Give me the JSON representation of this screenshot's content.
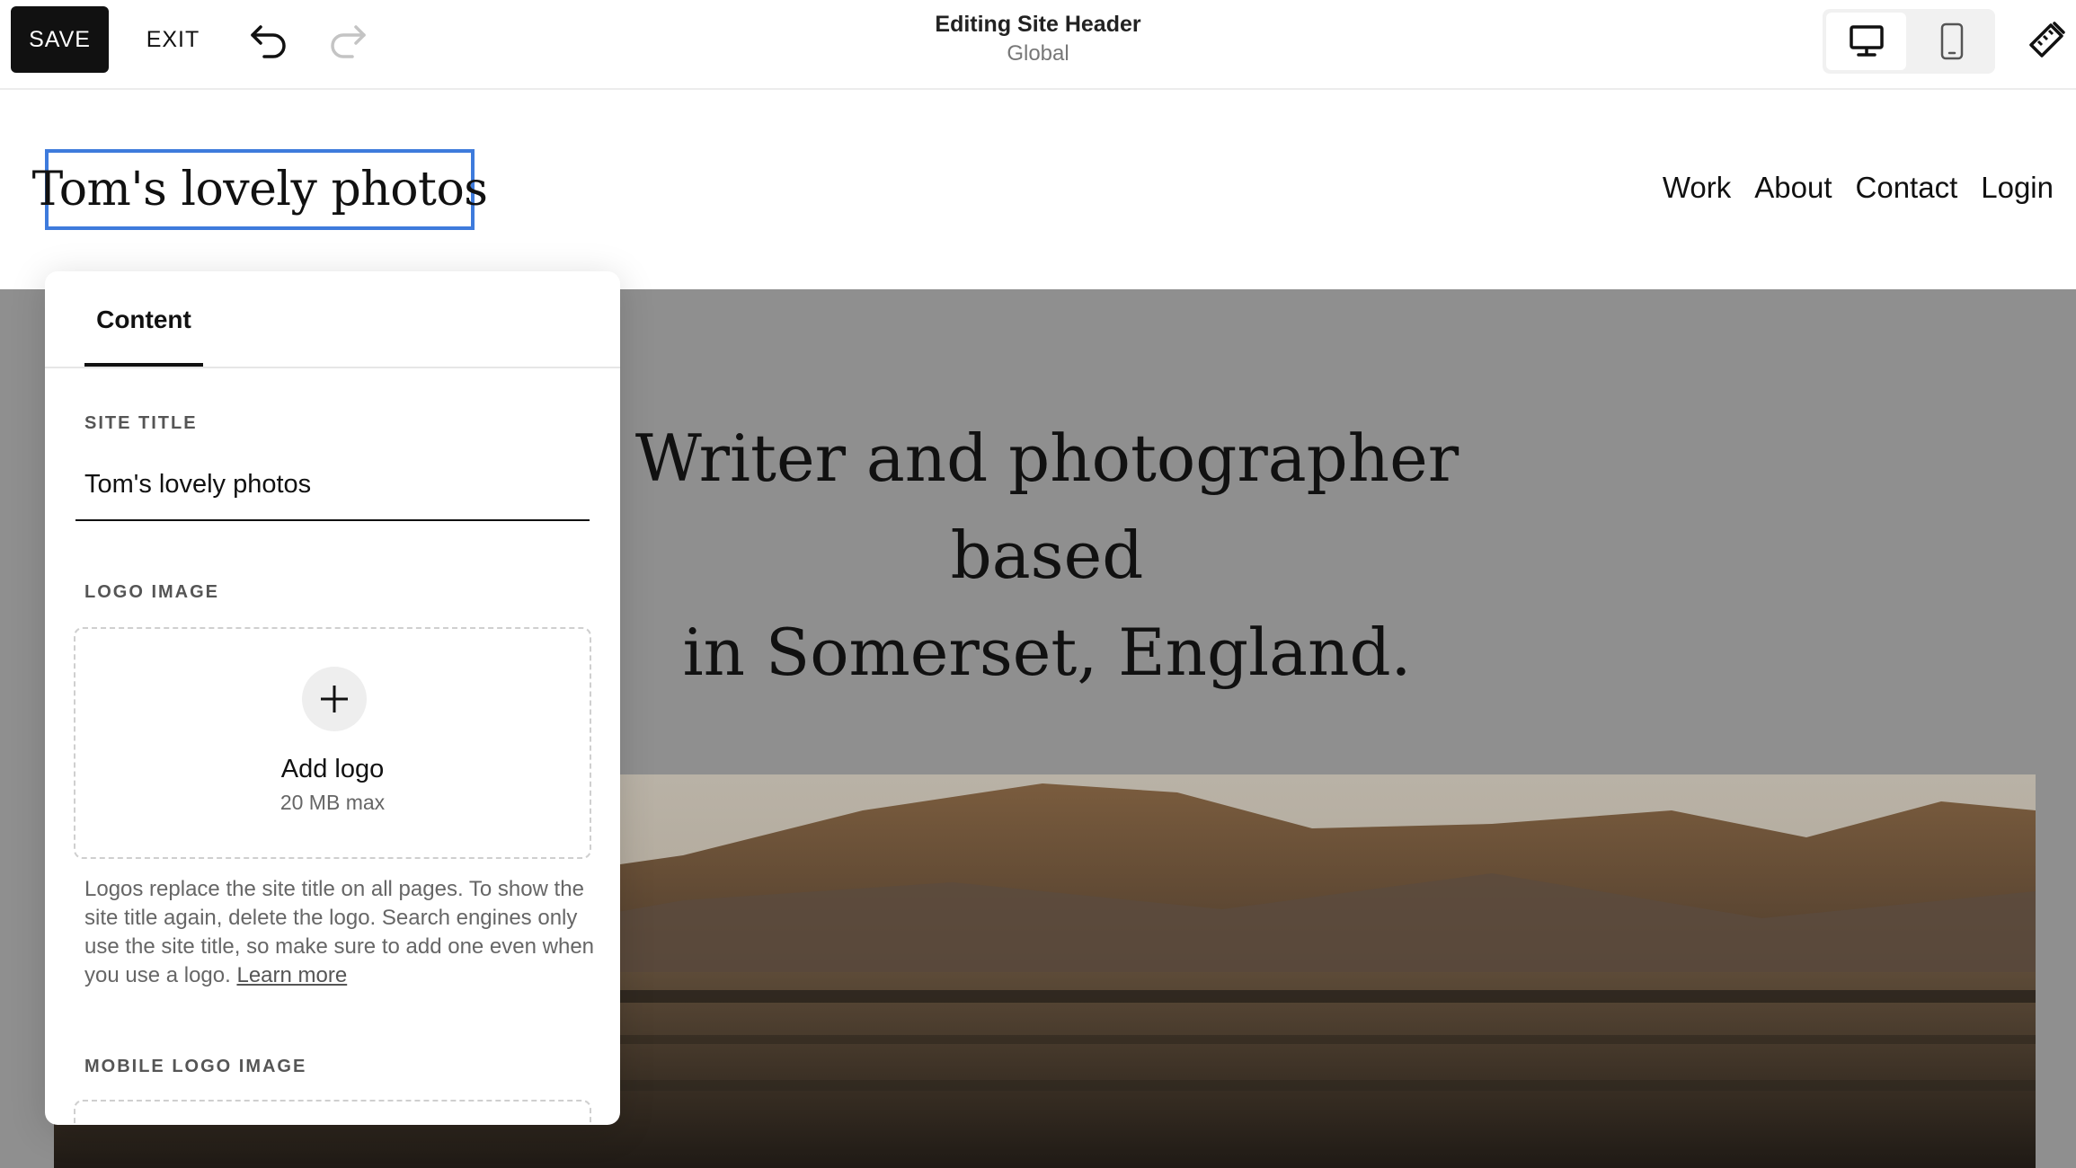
{
  "toolbar": {
    "save_label": "SAVE",
    "exit_label": "EXIT",
    "undo_icon": "undo-icon",
    "redo_icon": "redo-icon",
    "editing_title": "Editing Site Header",
    "editing_subtitle": "Global",
    "device_options": [
      "desktop-icon",
      "mobile-icon"
    ],
    "selected_device": "desktop",
    "design_icon": "paintbrush-ruler-icon"
  },
  "site": {
    "title": "Tom's lovely photos",
    "nav": [
      "Work",
      "About",
      "Contact",
      "Login"
    ],
    "hero_heading_line1": "Writer and photographer based",
    "hero_heading_line2": "in Somerset, England."
  },
  "panel": {
    "tabs": [
      {
        "label": "Content",
        "active": true
      }
    ],
    "site_title_label": "SITE TITLE",
    "site_title_value": "Tom's lovely photos",
    "logo_image_label": "LOGO IMAGE",
    "add_logo_label": "Add logo",
    "max_size": "20 MB max",
    "help_text": "Logos replace the site title on all pages. To show the site title again, delete the logo. Search engines only use the site title, so make sure to add one even when you use a logo.",
    "learn_more": "Learn more",
    "mobile_logo_label": "MOBILE LOGO IMAGE"
  },
  "colors": {
    "selection_outline": "#3e7bdc",
    "save_button_bg": "#111111",
    "hero_overlay": "#8f8f8f"
  }
}
